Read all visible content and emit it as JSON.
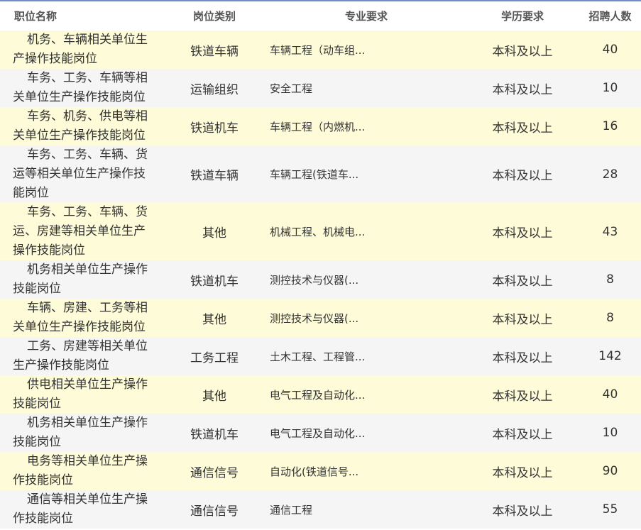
{
  "table": {
    "headers": {
      "name": "职位名称",
      "category": "岗位类别",
      "major": "专业要求",
      "education": "学历要求",
      "count": "招聘人数"
    },
    "rows": [
      {
        "name": "机务、车辆相关单位生产操作技能岗位",
        "category": "铁道车辆",
        "major": "车辆工程（动车组...",
        "education": "本科及以上",
        "count": "40"
      },
      {
        "name": "车务、工务、车辆等相关单位生产操作技能岗位",
        "category": "运输组织",
        "major": "安全工程",
        "education": "本科及以上",
        "count": "10"
      },
      {
        "name": "车务、机务、供电等相关单位生产操作技能岗位",
        "category": "铁道机车",
        "major": "车辆工程（内燃机...",
        "education": "本科及以上",
        "count": "16"
      },
      {
        "name": "车务、工务、车辆、货运等相关单位生产操作技能岗位",
        "category": "铁道车辆",
        "major": "车辆工程(铁道车...",
        "education": "本科及以上",
        "count": "28"
      },
      {
        "name": "车务、工务、车辆、货运、房建等相关单位生产操作技能岗位",
        "category": "其他",
        "major": "机械工程、机械电...",
        "education": "本科及以上",
        "count": "43"
      },
      {
        "name": "机务相关单位生产操作技能岗位",
        "category": "铁道机车",
        "major": "测控技术与仪器(...",
        "education": "本科及以上",
        "count": "8"
      },
      {
        "name": "车辆、房建、工务等相关单位生产操作技能岗位",
        "category": "其他",
        "major": "测控技术与仪器(...",
        "education": "本科及以上",
        "count": "8"
      },
      {
        "name": "工务、房建等相关单位生产操作技能岗位",
        "category": "工务工程",
        "major": "土木工程、工程管...",
        "education": "本科及以上",
        "count": "142"
      },
      {
        "name": "供电相关单位生产操作技能岗位",
        "category": "其他",
        "major": "电气工程及自动化...",
        "education": "本科及以上",
        "count": "40"
      },
      {
        "name": "机务相关单位生产操作技能岗位",
        "category": "铁道机车",
        "major": "电气工程及自动化...",
        "education": "本科及以上",
        "count": "10"
      },
      {
        "name": "电务等相关单位生产操作技能岗位",
        "category": "通信信号",
        "major": "自动化(铁道信号...",
        "education": "本科及以上",
        "count": "90"
      },
      {
        "name": "通信等相关单位生产操作技能岗位",
        "category": "通信信号",
        "major": "通信工程",
        "education": "本科及以上",
        "count": "55"
      }
    ]
  },
  "colors": {
    "header_border": "#6d8fc3",
    "row_odd": "#fdfbd8",
    "row_even": "#f5f5f5"
  }
}
